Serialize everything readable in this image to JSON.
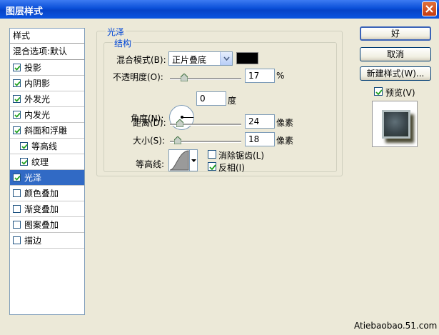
{
  "window": {
    "title": "图层样式"
  },
  "style_list": {
    "header": "样式",
    "blend_options": "混合选项:默认",
    "items": [
      {
        "label": "投影",
        "checked": true
      },
      {
        "label": "内阴影",
        "checked": true
      },
      {
        "label": "外发光",
        "checked": true
      },
      {
        "label": "内发光",
        "checked": true
      },
      {
        "label": "斜面和浮雕",
        "checked": true
      },
      {
        "label": "等高线",
        "checked": true
      },
      {
        "label": "纹理",
        "checked": true
      },
      {
        "label": "光泽",
        "checked": true,
        "selected": true
      },
      {
        "label": "颜色叠加",
        "checked": false
      },
      {
        "label": "渐变叠加",
        "checked": false
      },
      {
        "label": "图案叠加",
        "checked": false
      },
      {
        "label": "描边",
        "checked": false
      }
    ]
  },
  "satin": {
    "group_title": "光泽",
    "struct_title": "结构",
    "blend_mode_label": "混合模式(B):",
    "blend_mode_value": "正片叠底",
    "color": "#000000",
    "opacity_label": "不透明度(O):",
    "opacity_value": "17",
    "opacity_unit": "%",
    "angle_label": "角度(N):",
    "angle_value": "0",
    "angle_unit": "度",
    "distance_label": "距离(D):",
    "distance_value": "24",
    "distance_unit": "像素",
    "size_label": "大小(S):",
    "size_value": "18",
    "size_unit": "像素",
    "contour_label": "等高线:",
    "antialias_label": "消除锯齿(L)",
    "antialias_checked": false,
    "invert_label": "反相(I)",
    "invert_checked": true
  },
  "buttons": {
    "ok": "好",
    "cancel": "取消",
    "new_style": "新建样式(W)...",
    "preview_label": "预览(V)",
    "preview_checked": true
  },
  "watermark": "Atiebaobao.51.com"
}
